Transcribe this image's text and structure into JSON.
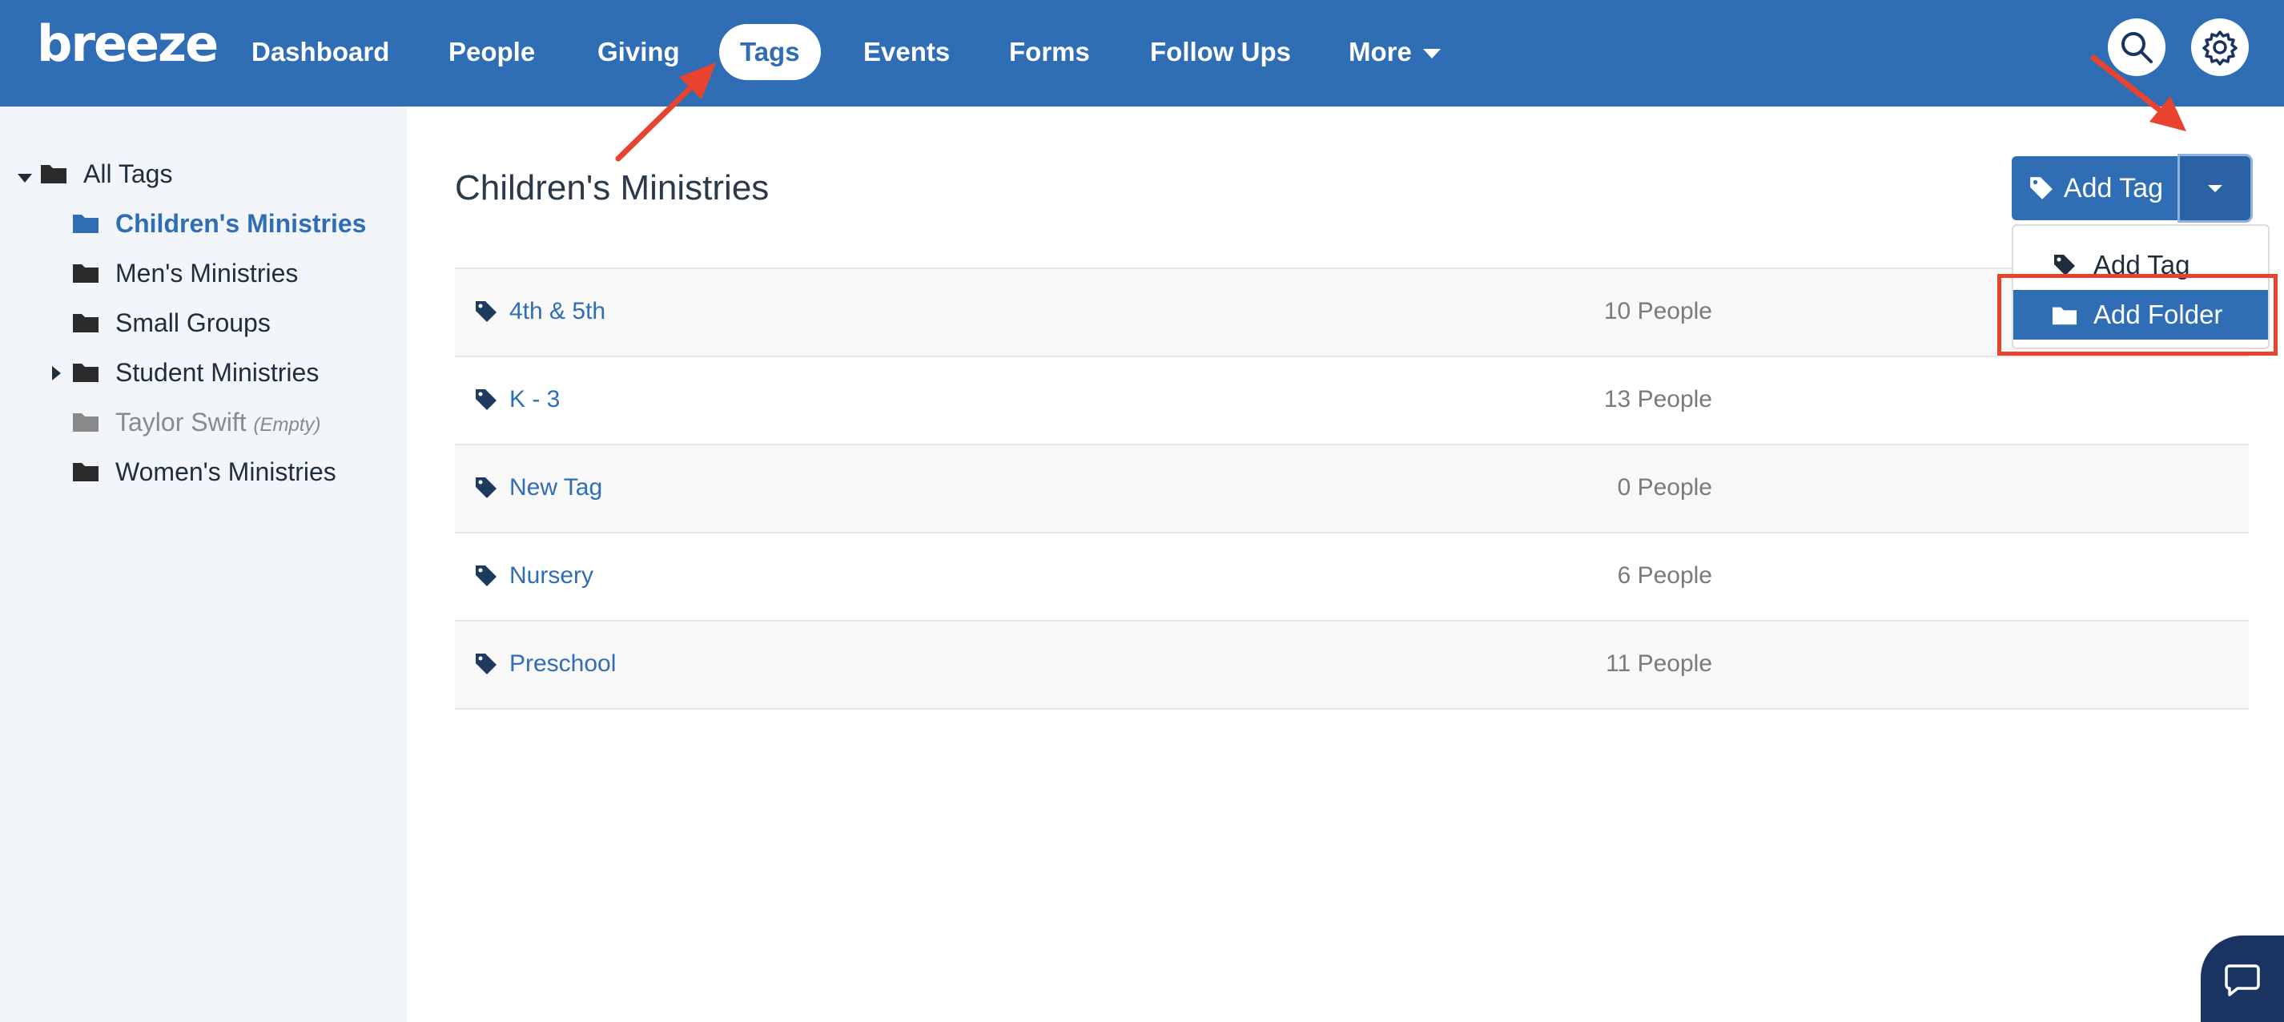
{
  "app": {
    "logo_text": "breeze"
  },
  "nav": {
    "items": [
      {
        "label": "Dashboard"
      },
      {
        "label": "People"
      },
      {
        "label": "Giving"
      },
      {
        "label": "Tags"
      },
      {
        "label": "Events"
      },
      {
        "label": "Forms"
      },
      {
        "label": "Follow Ups"
      },
      {
        "label": "More"
      }
    ],
    "active": "Tags",
    "icons": [
      "search-icon",
      "gear-icon",
      "chevron-down-icon"
    ]
  },
  "sidebar": {
    "root_label": "All Tags",
    "folders": [
      {
        "label": "Children's Ministries",
        "selected": true
      },
      {
        "label": "Men's Ministries"
      },
      {
        "label": "Small Groups"
      },
      {
        "label": "Student Ministries",
        "collapsed": true
      },
      {
        "label": "Taylor Swift",
        "note": "(Empty)"
      },
      {
        "label": "Women's Ministries"
      }
    ]
  },
  "main": {
    "title": "Children's Ministries",
    "tags": [
      {
        "name": "4th & 5th",
        "count": "10 People"
      },
      {
        "name": "K - 3",
        "count": "13 People"
      },
      {
        "name": "New Tag",
        "count": "0 People"
      },
      {
        "name": "Nursery",
        "count": "6 People"
      },
      {
        "name": "Preschool",
        "count": "11 People"
      }
    ]
  },
  "add_menu": {
    "button_label": "Add Tag",
    "items": [
      {
        "label": "Add Tag",
        "icon": "tag-icon"
      },
      {
        "label": "Add Folder",
        "icon": "folder-icon",
        "highlighted": true
      }
    ]
  },
  "colors": {
    "brand": "#2f6db5",
    "sidebar_bg": "#f2f6fb",
    "annotation": "#e8432e",
    "chat_bg": "#1a3461"
  }
}
